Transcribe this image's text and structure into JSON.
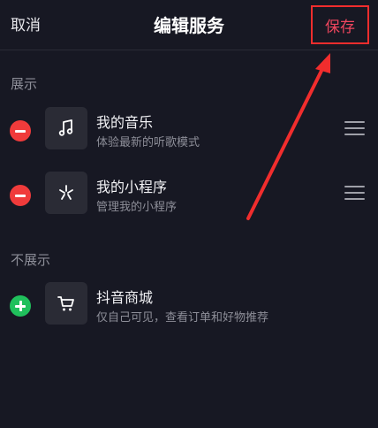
{
  "header": {
    "cancel_label": "取消",
    "title": "编辑服务",
    "save_label": "保存"
  },
  "sections": {
    "shown_label": "展示",
    "hidden_label": "不展示"
  },
  "shown_items": [
    {
      "title": "我的音乐",
      "subtitle": "体验最新的听歌模式",
      "icon": "music-note-icon"
    },
    {
      "title": "我的小程序",
      "subtitle": "管理我的小程序",
      "icon": "mini-program-icon"
    }
  ],
  "hidden_items": [
    {
      "title": "抖音商城",
      "subtitle": "仅自己可见，查看订单和好物推荐",
      "icon": "shopping-cart-icon"
    }
  ],
  "colors": {
    "background": "#171823",
    "remove": "#f03b3b",
    "add": "#20c05c",
    "save": "#f0465e",
    "annotation": "#f12d2d"
  }
}
